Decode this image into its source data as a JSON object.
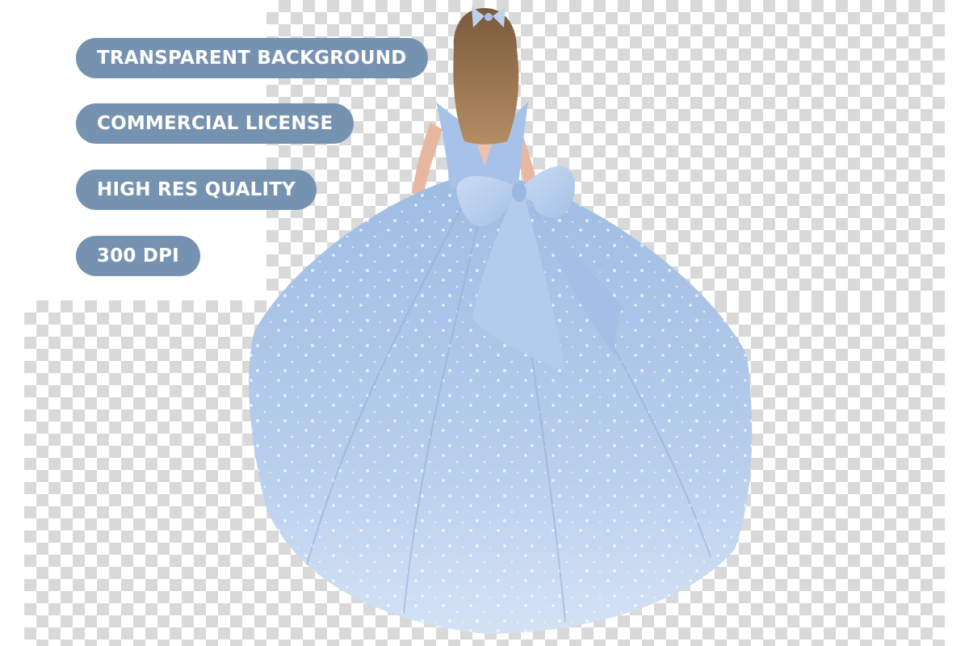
{
  "badges": [
    {
      "label": "TRANSPARENT BACKGROUND"
    },
    {
      "label": "COMMERCIAL LICENSE"
    },
    {
      "label": "HIGH RES QUALITY"
    },
    {
      "label": "300 DPI"
    }
  ],
  "colors": {
    "badge_background": "#7592b0",
    "badge_text": "#ffffff",
    "dress": "#a9c4e6",
    "hair": "#9a7550",
    "checker": "#d9d9d9"
  },
  "illustration": {
    "subject": "girl-in-blue-ball-gown-back-view"
  }
}
